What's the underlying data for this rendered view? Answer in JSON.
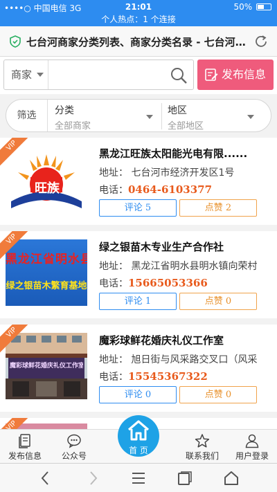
{
  "status_bar": {
    "carrier": "••••○ 中国电信  3G",
    "time": "21:01",
    "battery": "50%",
    "battery_level": 0.5
  },
  "hotspot_text": "个人热点：1 个连接",
  "browser": {
    "page_title": "七台河商家分类列表、商家分类名录 - 七台河信..."
  },
  "search": {
    "category": "商家",
    "placeholder": "",
    "publish_label": "发布信息"
  },
  "filter": {
    "label": "筛选",
    "category_heading": "分类",
    "category_value": "全部商家",
    "region_heading": "地区",
    "region_value": "全部地区"
  },
  "listings": [
    {
      "vip": "VIP",
      "name": "黑龙江旺族太阳能光电有限......",
      "address": "地址：  七台河市经济开发区1号",
      "phone_label": "电话：",
      "phone": "0464-6103377",
      "comment": "评论 5",
      "like": "点赞 2",
      "logo_text": "旺族"
    },
    {
      "vip": "VIP",
      "name": "绿之银苗木专业生产合作社",
      "address": "地址：  黑龙江省明水县明水镇向荣村",
      "phone_label": "电话：",
      "phone": "15665053366",
      "comment": "评论 1",
      "like": "点赞 0",
      "banner_line1": "黑龙江省明水县",
      "banner_line2": "绿之银苗木繁育基地"
    },
    {
      "vip": "VIP",
      "name": "魔彩球鲜花婚庆礼仪工作室",
      "address": "地址：  旭日街与风采路交叉口（风采",
      "phone_label": "电话：",
      "phone": "15545367322",
      "comment": "评论 0",
      "like": "点赞 0",
      "sign_text": "魔彩球鲜花婚庆礼仪工作室"
    }
  ],
  "bottom_nav": {
    "publish": "发布信息",
    "official": "公众号",
    "home": "首 页",
    "contact": "联系我们",
    "login": "用户登录"
  },
  "colors": {
    "accent": "#2d8cf0",
    "publish_button": "#ef5b7c",
    "phone": "#e85a1c",
    "vip": "#f07b3b",
    "home": "#1ea2e6"
  }
}
